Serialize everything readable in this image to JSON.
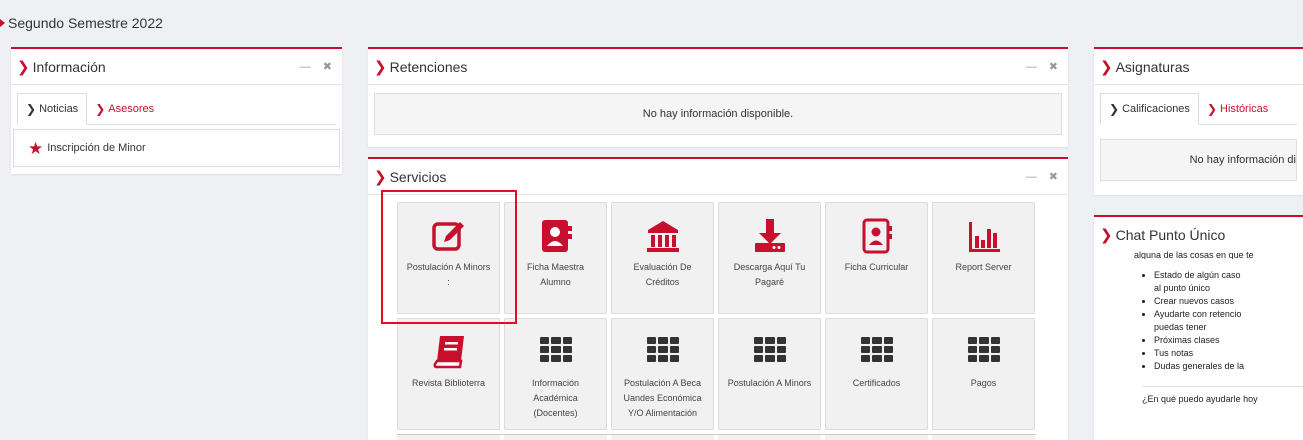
{
  "semester": "Segundo Semestre 2022",
  "informacion": {
    "title": "Información",
    "tabs": [
      "Noticias",
      "Asesores"
    ],
    "minor_item": "Inscripción de Minor"
  },
  "retenciones": {
    "title": "Retenciones",
    "empty_text": "No hay información disponible."
  },
  "servicios": {
    "title": "Servicios",
    "row1": [
      {
        "label": "Postulación A Minors",
        "sub": ":",
        "icon": "edit-icon"
      },
      {
        "label": "Ficha Maestra",
        "sub": "Alumno",
        "icon": "contact-book-icon"
      },
      {
        "label": "Evaluación De",
        "sub": "Créditos",
        "icon": "bank-icon"
      },
      {
        "label": "Descarga Aquí Tu",
        "sub": "Pagaré",
        "icon": "download-icon"
      },
      {
        "label": "Ficha Curricular",
        "sub": "",
        "icon": "contact-book-icon"
      },
      {
        "label": "Report Server",
        "sub": "",
        "icon": "bar-chart-icon"
      }
    ],
    "row2": [
      {
        "label": "Revista Biblioterra",
        "l2": "",
        "l3": "",
        "icon": "book-icon"
      },
      {
        "label": "Información",
        "l2": "Académica",
        "l3": "(Docentes)",
        "icon": "grid-icon"
      },
      {
        "label": "Postulación A Beca",
        "l2": "Uandes Económica",
        "l3": "Y/O Alimentación",
        "icon": "grid-icon"
      },
      {
        "label": "Postulación A Minors",
        "l2": "",
        "l3": "",
        "icon": "grid-icon"
      },
      {
        "label": "Certificados",
        "l2": "",
        "l3": "",
        "icon": "grid-icon"
      },
      {
        "label": "Pagos",
        "l2": "",
        "l3": "",
        "icon": "grid-icon"
      }
    ]
  },
  "asignaturas": {
    "title": "Asignaturas",
    "tabs": [
      "Calificaciones",
      "Históricas"
    ],
    "empty_text": "No hay información di"
  },
  "chat": {
    "title": "Chat Punto Único",
    "intro": "alguna de las cosas en que te",
    "items": [
      "Estado de algún caso",
      "al punto único",
      "Crear nuevos casos",
      "Ayudarte con retencio",
      "puedas tener",
      "Próximas clases",
      "Tus notas",
      "Dudas generales de la"
    ],
    "question": "¿En qué puedo ayudarle hoy"
  },
  "colors": {
    "accent": "#c8102e",
    "highlight": "#e10f1f",
    "background": "#eef0f4"
  }
}
